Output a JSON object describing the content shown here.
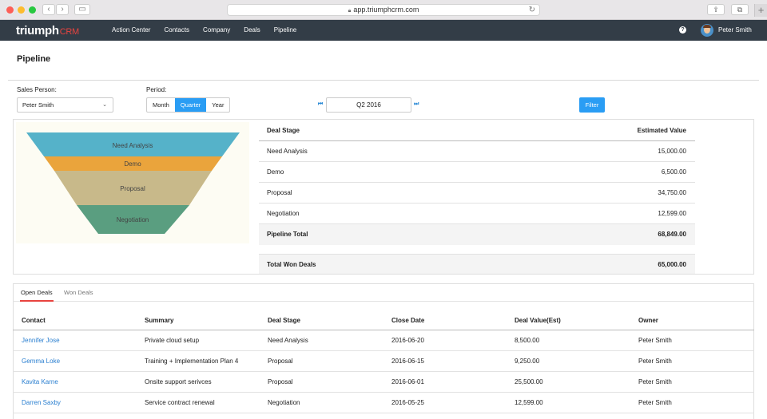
{
  "browser": {
    "url": "app.triumphcrm.com"
  },
  "app": {
    "logo_main": "triumph",
    "logo_accent": "CRM",
    "nav": [
      "Action Center",
      "Contacts",
      "Company",
      "Deals",
      "Pipeline"
    ],
    "user_name": "Peter Smith"
  },
  "page": {
    "title": "Pipeline"
  },
  "filters": {
    "sales_person_label": "Sales Person:",
    "sales_person_value": "Peter Smith",
    "period_label": "Period:",
    "period_options": [
      "Month",
      "Quarter",
      "Year"
    ],
    "period_selected": "Quarter",
    "period_value": "Q2 2016",
    "filter_button": "Filter"
  },
  "funnel": {
    "stages": [
      {
        "label": "Need Analysis",
        "color": "#55b2c9"
      },
      {
        "label": "Demo",
        "color": "#eaa43c"
      },
      {
        "label": "Proposal",
        "color": "#c8b98a"
      },
      {
        "label": "Negotiation",
        "color": "#5a9e80"
      }
    ]
  },
  "stage_table": {
    "headers": [
      "Deal Stage",
      "Estimated Value"
    ],
    "rows": [
      {
        "stage": "Need Analysis",
        "value": "15,000.00"
      },
      {
        "stage": "Demo",
        "value": "6,500.00"
      },
      {
        "stage": "Proposal",
        "value": "34,750.00"
      },
      {
        "stage": "Negotiation",
        "value": "12,599.00"
      }
    ],
    "total_label": "Pipeline Total",
    "total_value": "68,849.00",
    "won_label": "Total Won Deals",
    "won_value": "65,000.00"
  },
  "deals": {
    "tabs": [
      "Open Deals",
      "Won Deals"
    ],
    "active_tab": "Open Deals",
    "headers": [
      "Contact",
      "Summary",
      "Deal Stage",
      "Close Date",
      "Deal Value(Est)",
      "Owner"
    ],
    "rows": [
      {
        "contact": "Jennifer Jose",
        "summary": "Private cloud setup",
        "stage": "Need Analysis",
        "date": "2016-06-20",
        "value": "8,500.00",
        "owner": "Peter Smith"
      },
      {
        "contact": "Gemma Loke",
        "summary": "Training + Implementation Plan 4",
        "stage": "Proposal",
        "date": "2016-06-15",
        "value": "9,250.00",
        "owner": "Peter Smith"
      },
      {
        "contact": "Kavita Karne",
        "summary": "Onsite support serivces",
        "stage": "Proposal",
        "date": "2016-06-01",
        "value": "25,500.00",
        "owner": "Peter Smith"
      },
      {
        "contact": "Darren Saxby",
        "summary": "Service contract renewal",
        "stage": "Negotiation",
        "date": "2016-05-25",
        "value": "12,599.00",
        "owner": "Peter Smith"
      }
    ]
  }
}
